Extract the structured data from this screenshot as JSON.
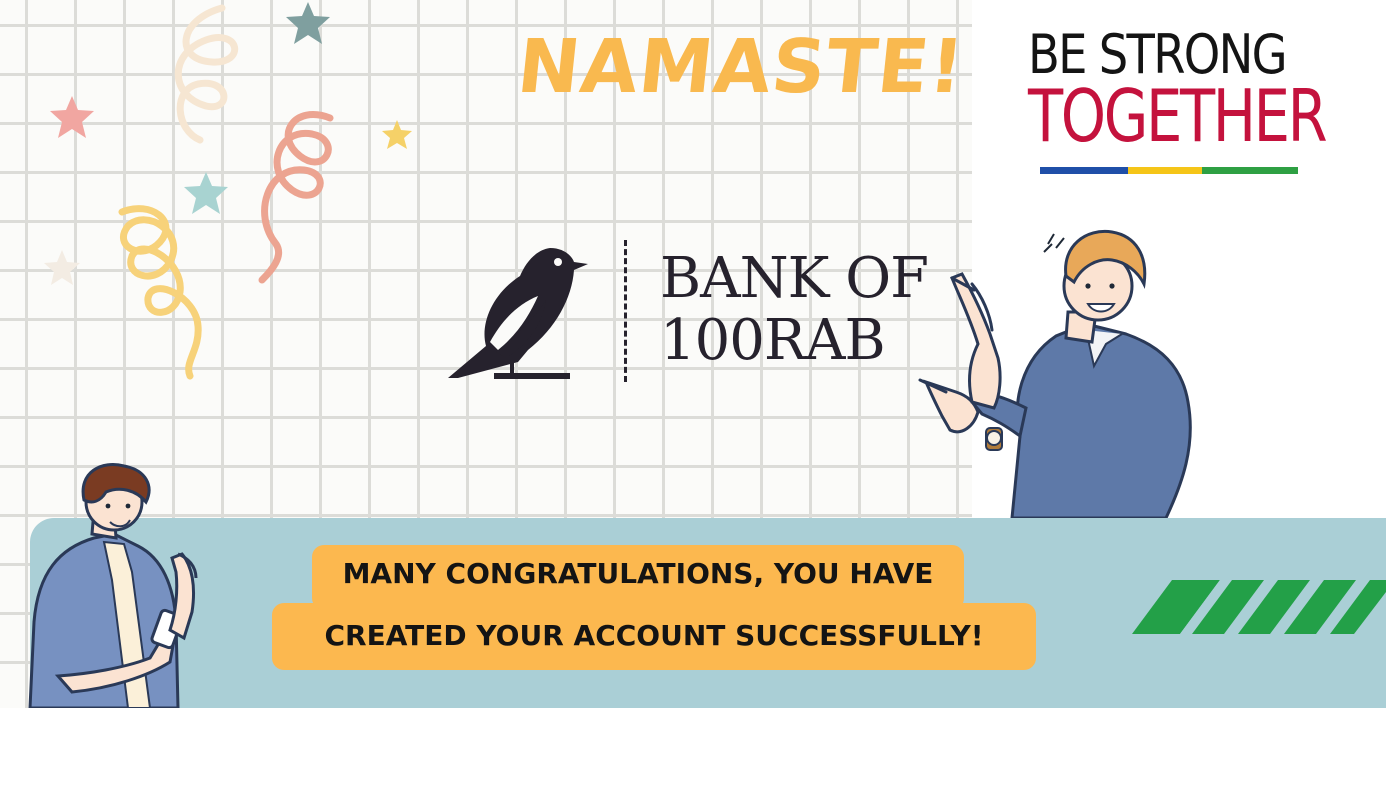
{
  "banner": {
    "greeting": "NAMASTE!",
    "slogan": {
      "line1": "BE STRONG",
      "line2": "TOGETHER",
      "underline_colors": [
        "#1f4fa8",
        "#f5c518",
        "#2ea043"
      ]
    },
    "logo": {
      "icon": "bird-icon",
      "name_line1": "BANK OF",
      "name_line2": "100RAB"
    },
    "message": {
      "line1": "MANY CONGRATULATIONS, YOU HAVE",
      "line2": "CREATED YOUR ACCOUNT SUCCESSFULLY!"
    },
    "colors": {
      "greeting": "#f9b94f",
      "message_bg": "#fcb84f",
      "band": "#aacfd6",
      "slogan_red": "#c4123d",
      "stripes": "#23a048"
    },
    "decorations": [
      "star-icon",
      "confetti-ribbon-icon",
      "pointing-man-illustration",
      "phone-man-illustration",
      "diagonal-stripes-icon"
    ]
  }
}
